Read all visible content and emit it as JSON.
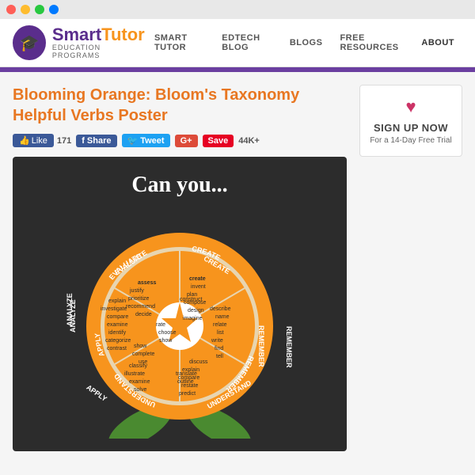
{
  "browser": {
    "dots": [
      "#ff5f57",
      "#febc2e",
      "#28c840",
      "#007aff"
    ]
  },
  "header": {
    "logo_smart": "Smart",
    "logo_tutor": "Tutor",
    "logo_sub": "EDUCATION PROGRAMS",
    "nav": [
      {
        "label": "SMART TUTOR",
        "href": "#"
      },
      {
        "label": "EDTECH BLOG",
        "href": "#"
      },
      {
        "label": "BLOGS",
        "href": "#"
      },
      {
        "label": "FREE RESOURCES",
        "href": "#"
      },
      {
        "label": "ABOUT",
        "href": "#",
        "active": true
      }
    ]
  },
  "page": {
    "title": "Blooming Orange: Bloom's Taxonomy Helpful Verbs Poster",
    "poster_headline": "Can you...",
    "social": {
      "like_label": "Like",
      "like_count": "171",
      "share_label": "Share",
      "tweet_label": "Tweet",
      "gplus_label": "G+",
      "save_label": "Save",
      "save_count": "44K+"
    }
  },
  "sidebar": {
    "heart_icon": "♥",
    "signup_title": "SIGN UP NOW",
    "signup_sub": "For a 14-Day Free Trial"
  },
  "diagram": {
    "sections": [
      {
        "label": "EVALUATE",
        "color": "#e8a020",
        "angle": -135,
        "verbs": [
          "assess",
          "justify",
          "prioritize",
          "recommend",
          "decide"
        ]
      },
      {
        "label": "CREATE",
        "color": "#e8a020",
        "angle": -45,
        "verbs": [
          "create",
          "invent",
          "plan",
          "compose",
          "design",
          "imagine",
          "construct"
        ]
      },
      {
        "label": "REMEMBER",
        "color": "#e8a020",
        "angle": 45,
        "verbs": [
          "describe",
          "name",
          "relate",
          "list",
          "write",
          "find",
          "tell",
          "discuss"
        ]
      },
      {
        "label": "UNDERSTAND",
        "color": "#e8a020",
        "angle": 135,
        "verbs": [
          "explain",
          "compare",
          "restate",
          "predict",
          "translate",
          "outline"
        ]
      },
      {
        "label": "APPLY",
        "color": "#e8a020",
        "angle": 160,
        "verbs": [
          "classify",
          "illustrate",
          "complete",
          "use",
          "examine",
          "show",
          "solve"
        ]
      },
      {
        "label": "ANALYZE",
        "color": "#e8a020",
        "angle": -160,
        "verbs": [
          "compare",
          "examine",
          "identify",
          "categorize",
          "contrast",
          "investigate",
          "explain"
        ]
      }
    ]
  }
}
